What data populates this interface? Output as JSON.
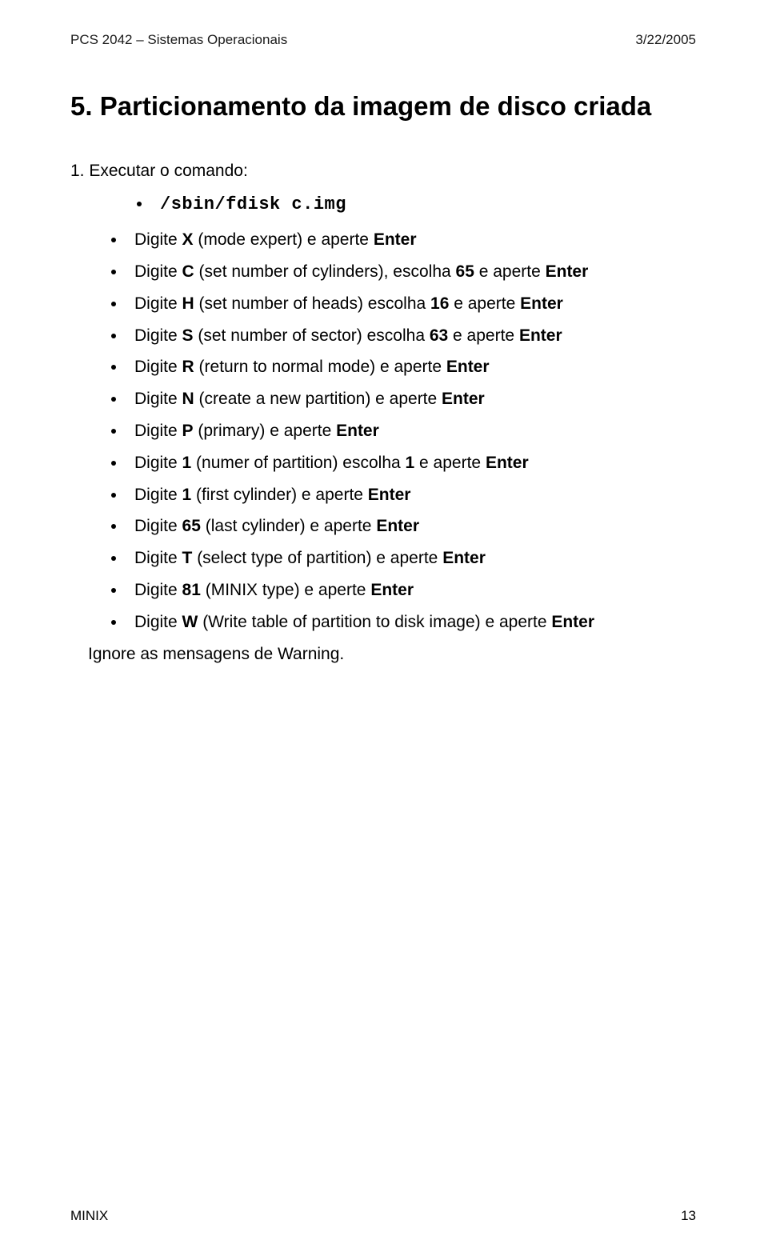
{
  "header": {
    "left": "PCS 2042 – Sistemas Operacionais",
    "right": "3/22/2005"
  },
  "section": {
    "title": "5. Particionamento da imagem de disco criada"
  },
  "lead": "1. Executar o comando:",
  "command": {
    "bullet_html": "<span class='cmd'>/sbin/fdisk c.img</span>"
  },
  "steps": [
    "Digite <b>X</b> (mode expert) e aperte <b>Enter</b>",
    "Digite <b>C</b> (set number of cylinders), escolha <b>65</b> e aperte <b>Enter</b>",
    "Digite <b>H</b> (set number of heads) escolha <b>16</b> e aperte <b>Enter</b>",
    "Digite <b>S</b> (set number of sector) escolha <b>63</b> e aperte <b>Enter</b>",
    "Digite <b>R</b> (return to normal mode) e aperte <b>Enter</b>",
    "Digite <b>N</b> (create a new partition) e aperte <b>Enter</b>",
    "Digite <b>P</b> (primary) e aperte <b>Enter</b>",
    "Digite <b>1</b> (numer of partition) escolha <b>1</b> e aperte <b>Enter</b>",
    "Digite <b>1</b> (first cylinder) e aperte <b>Enter</b>",
    "Digite <b>65</b> (last cylinder) e aperte <b>Enter</b>",
    "Digite <b>T</b> (select type of partition) e aperte <b>Enter</b>",
    "Digite <b>81</b> (MINIX type) e aperte <b>Enter</b>",
    "Digite <b>W</b> (Write table of partition to disk image) e aperte <b>Enter</b>"
  ],
  "ignore_line": "Ignore as mensagens de Warning.",
  "footer": {
    "left": "MINIX",
    "right": "13"
  }
}
